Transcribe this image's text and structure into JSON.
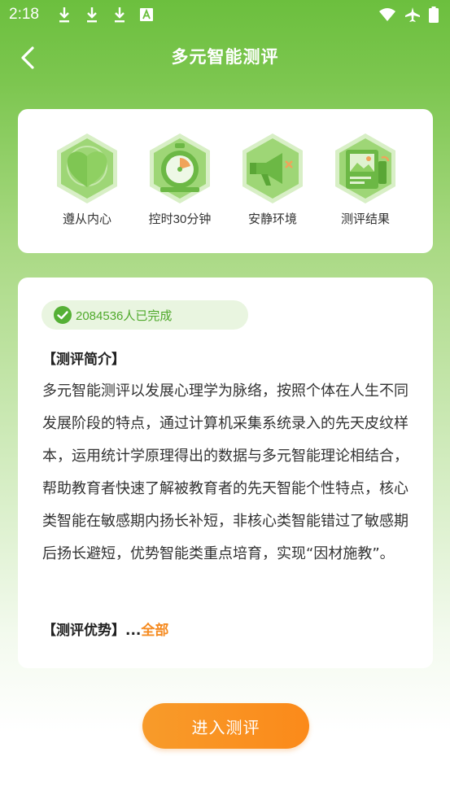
{
  "status_bar": {
    "time": "2:18",
    "icons": [
      "download-icon",
      "download-icon",
      "download-icon",
      "a-box-icon",
      "wifi-icon",
      "airplane-icon",
      "battery-icon"
    ]
  },
  "app_bar": {
    "title": "多元智能测评",
    "back_icon": "chevron-left-icon"
  },
  "features": [
    {
      "label": "遵从内心",
      "icon": "heart-icon"
    },
    {
      "label": "控时30分钟",
      "icon": "stopwatch-icon"
    },
    {
      "label": "安静环境",
      "icon": "megaphone-icon"
    },
    {
      "label": "测评结果",
      "icon": "report-icon"
    }
  ],
  "main": {
    "completed_count": "2084536人已完成",
    "intro_title": "【测评简介】",
    "intro_body": "多元智能测评以发展心理学为脉络，按照个体在人生不同发展阶段的特点，通过计算机采集系统录入的先天皮纹样本，运用统计学原理得出的数据与多元智能理论相结合，帮助教育者快速了解被教育者的先天智能个性特点，核心类智能在敏感期内扬长补短，非核心类智能错过了敏感期后扬长避短，优势智能类重点培育，实现“因材施教”。",
    "advantage_title": "【测评优势】",
    "advantage_ellipsis": "...",
    "advantage_more": "全部"
  },
  "enter_button": "进入测评",
  "colors": {
    "primary_green": "#6cbf3e",
    "accent_orange": "#f58a1f",
    "badge_text": "#4fa92b"
  }
}
